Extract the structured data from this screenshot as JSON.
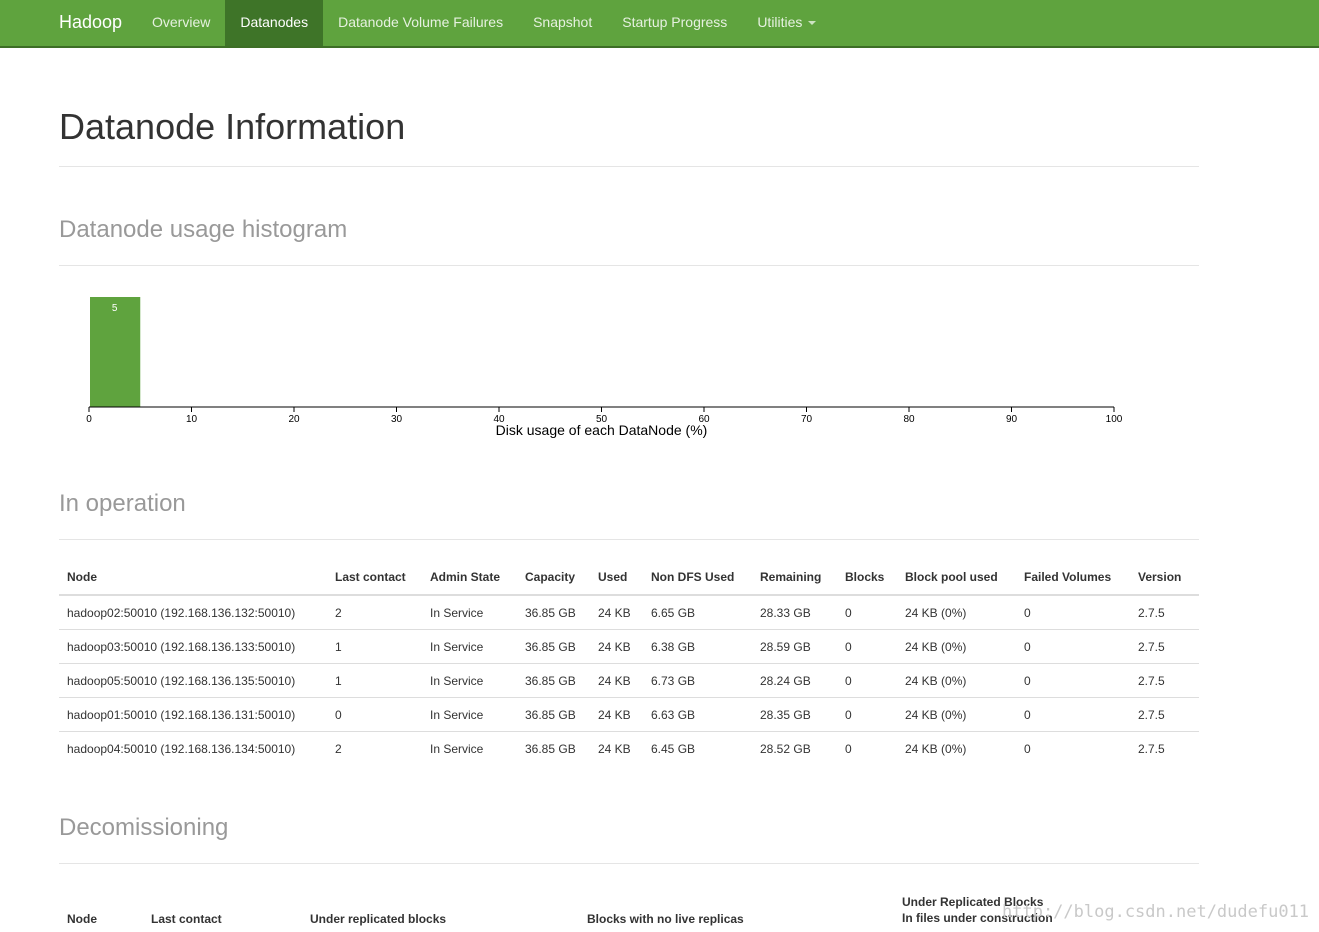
{
  "navbar": {
    "brand": "Hadoop",
    "items": [
      {
        "label": "Overview"
      },
      {
        "label": "Datanodes"
      },
      {
        "label": "Datanode Volume Failures"
      },
      {
        "label": "Snapshot"
      },
      {
        "label": "Startup Progress"
      },
      {
        "label": "Utilities"
      }
    ]
  },
  "page_title": "Datanode Information",
  "histogram": {
    "section_title": "Datanode usage histogram"
  },
  "chart_data": {
    "type": "bar",
    "bins": [
      [
        0,
        5
      ]
    ],
    "values": [
      5
    ],
    "xlim": [
      0,
      100
    ],
    "xticks": [
      0,
      10,
      20,
      30,
      40,
      50,
      60,
      70,
      80,
      90,
      100
    ],
    "xlabel": "Disk usage of each DataNode (%)",
    "bar_color": "#5fa33e"
  },
  "in_operation": {
    "section_title": "In operation",
    "columns": [
      "Node",
      "Last contact",
      "Admin State",
      "Capacity",
      "Used",
      "Non DFS Used",
      "Remaining",
      "Blocks",
      "Block pool used",
      "Failed Volumes",
      "Version"
    ],
    "rows": [
      [
        "hadoop02:50010 (192.168.136.132:50010)",
        "2",
        "In Service",
        "36.85 GB",
        "24 KB",
        "6.65 GB",
        "28.33 GB",
        "0",
        "24 KB (0%)",
        "0",
        "2.7.5"
      ],
      [
        "hadoop03:50010 (192.168.136.133:50010)",
        "1",
        "In Service",
        "36.85 GB",
        "24 KB",
        "6.38 GB",
        "28.59 GB",
        "0",
        "24 KB (0%)",
        "0",
        "2.7.5"
      ],
      [
        "hadoop05:50010 (192.168.136.135:50010)",
        "1",
        "In Service",
        "36.85 GB",
        "24 KB",
        "6.73 GB",
        "28.24 GB",
        "0",
        "24 KB (0%)",
        "0",
        "2.7.5"
      ],
      [
        "hadoop01:50010 (192.168.136.131:50010)",
        "0",
        "In Service",
        "36.85 GB",
        "24 KB",
        "6.63 GB",
        "28.35 GB",
        "0",
        "24 KB (0%)",
        "0",
        "2.7.5"
      ],
      [
        "hadoop04:50010 (192.168.136.134:50010)",
        "2",
        "In Service",
        "36.85 GB",
        "24 KB",
        "6.45 GB",
        "28.52 GB",
        "0",
        "24 KB (0%)",
        "0",
        "2.7.5"
      ]
    ]
  },
  "decommissioning": {
    "section_title": "Decomissioning",
    "columns": {
      "node": "Node",
      "last_contact": "Last contact",
      "under_replicated": "Under replicated blocks",
      "no_live_replicas": "Blocks with no live replicas",
      "under_construction_line1": "Under Replicated Blocks",
      "under_construction_line2": "In files under construction"
    }
  },
  "watermark": "http://blog.csdn.net/dudefu011",
  "colors": {
    "navbar": "#5fa33e",
    "navbar_active": "#3e7428",
    "bar": "#5fa33e"
  }
}
